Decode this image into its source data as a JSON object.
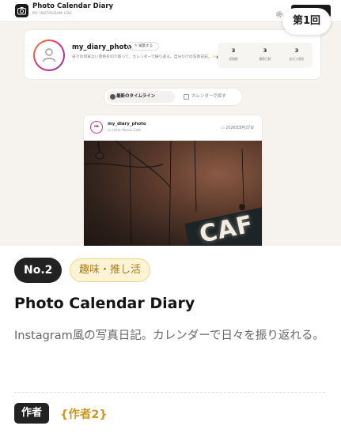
{
  "preview": {
    "app_title": "Photo Calendar Diary",
    "app_subtitle": "MY INSTAGRAM LOG",
    "round_badge": "第1回",
    "profile": {
      "username": "my_diary_photo",
      "edit_label": "✎ 編集する",
      "bio": "日々の何気ない景色を切り取って、カレンダーで振り返る。自分だけの写真日記。✨📷",
      "stats": [
        {
          "value": "3",
          "label": "投稿数"
        },
        {
          "value": "3",
          "label": "撮影日数"
        },
        {
          "value": "3",
          "label": "訪れた場所"
        }
      ]
    },
    "toggle": {
      "active_label": "最新のタイムライン",
      "inactive_label": "カレンダーで探す"
    },
    "post": {
      "avatar_text": "ME",
      "username": "my_diary_photo",
      "location": "◎ Little Wood Cafe",
      "date": "2026年8月27日",
      "sign_text": "CAF"
    }
  },
  "card": {
    "number_badge": "No.2",
    "category": "趣味・推し活",
    "title": "Photo Calendar Diary",
    "description": "Instagram風の写真日記。カレンダーで日々を振り返れる。",
    "author_label": "作者",
    "author_name": "{作者2}"
  }
}
